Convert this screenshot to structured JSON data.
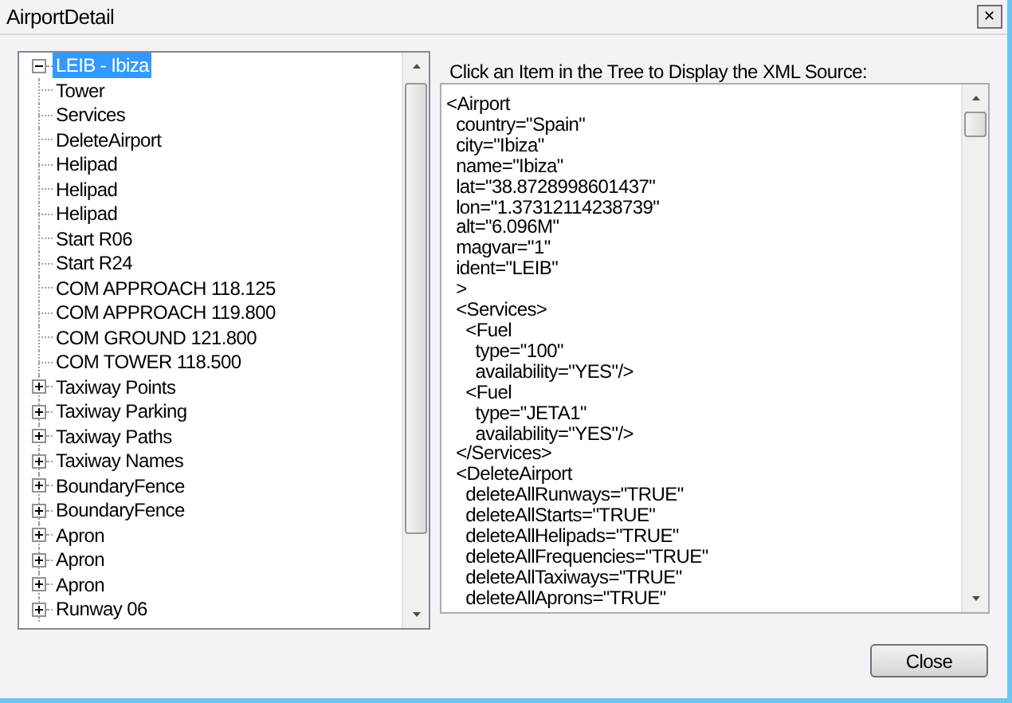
{
  "window": {
    "title": "AirportDetail",
    "close_glyph": "✕"
  },
  "tree": {
    "label": "LEIB - Ibiza",
    "selected": true,
    "expanded": true,
    "children": [
      {
        "label": "Tower",
        "kind": "leaf",
        "selected": false
      },
      {
        "label": "Services",
        "kind": "leaf",
        "selected": false
      },
      {
        "label": "DeleteAirport",
        "kind": "leaf",
        "selected": false
      },
      {
        "label": "Helipad",
        "kind": "leaf",
        "selected": false
      },
      {
        "label": "Helipad",
        "kind": "leaf",
        "selected": false
      },
      {
        "label": "Helipad",
        "kind": "leaf",
        "selected": false
      },
      {
        "label": "Start R06",
        "kind": "leaf",
        "selected": false
      },
      {
        "label": "Start R24",
        "kind": "leaf",
        "selected": false
      },
      {
        "label": "COM APPROACH 118.125",
        "kind": "leaf",
        "selected": false
      },
      {
        "label": "COM APPROACH 119.800",
        "kind": "leaf",
        "selected": false
      },
      {
        "label": "COM GROUND 121.800",
        "kind": "leaf",
        "selected": false
      },
      {
        "label": "COM TOWER 118.500",
        "kind": "leaf",
        "selected": false
      },
      {
        "label": "Taxiway Points",
        "kind": "group",
        "expanded": false,
        "selected": false
      },
      {
        "label": "Taxiway Parking",
        "kind": "group",
        "expanded": false,
        "selected": false
      },
      {
        "label": "Taxiway Paths",
        "kind": "group",
        "expanded": false,
        "selected": false
      },
      {
        "label": "Taxiway Names",
        "kind": "group",
        "expanded": false,
        "selected": false
      },
      {
        "label": "BoundaryFence",
        "kind": "group",
        "expanded": false,
        "selected": false
      },
      {
        "label": "BoundaryFence",
        "kind": "group",
        "expanded": false,
        "selected": false
      },
      {
        "label": "Apron",
        "kind": "group",
        "expanded": false,
        "selected": false
      },
      {
        "label": "Apron",
        "kind": "group",
        "expanded": false,
        "selected": false
      },
      {
        "label": "Apron",
        "kind": "group",
        "expanded": false,
        "selected": false
      },
      {
        "label": "Runway 06",
        "kind": "group",
        "expanded": false,
        "selected": false
      }
    ]
  },
  "xml_panel": {
    "label": "Click an Item in the Tree to Display the XML Source:",
    "lines": [
      "<Airport",
      "  country=\"Spain\"",
      "  city=\"Ibiza\"",
      "  name=\"Ibiza\"",
      "  lat=\"38.8728998601437\"",
      "  lon=\"1.37312114238739\"",
      "  alt=\"6.096M\"",
      "  magvar=\"1\"",
      "  ident=\"LEIB\"",
      "  >",
      "  <Services>",
      "    <Fuel",
      "      type=\"100\"",
      "      availability=\"YES\"/>",
      "    <Fuel",
      "      type=\"JETA1\"",
      "      availability=\"YES\"/>",
      "  </Services>",
      "  <DeleteAirport",
      "    deleteAllRunways=\"TRUE\"",
      "    deleteAllStarts=\"TRUE\"",
      "    deleteAllHelipads=\"TRUE\"",
      "    deleteAllFrequencies=\"TRUE\"",
      "    deleteAllTaxiways=\"TRUE\"",
      "    deleteAllAprons=\"TRUE\""
    ]
  },
  "buttons": [
    "Close"
  ]
}
